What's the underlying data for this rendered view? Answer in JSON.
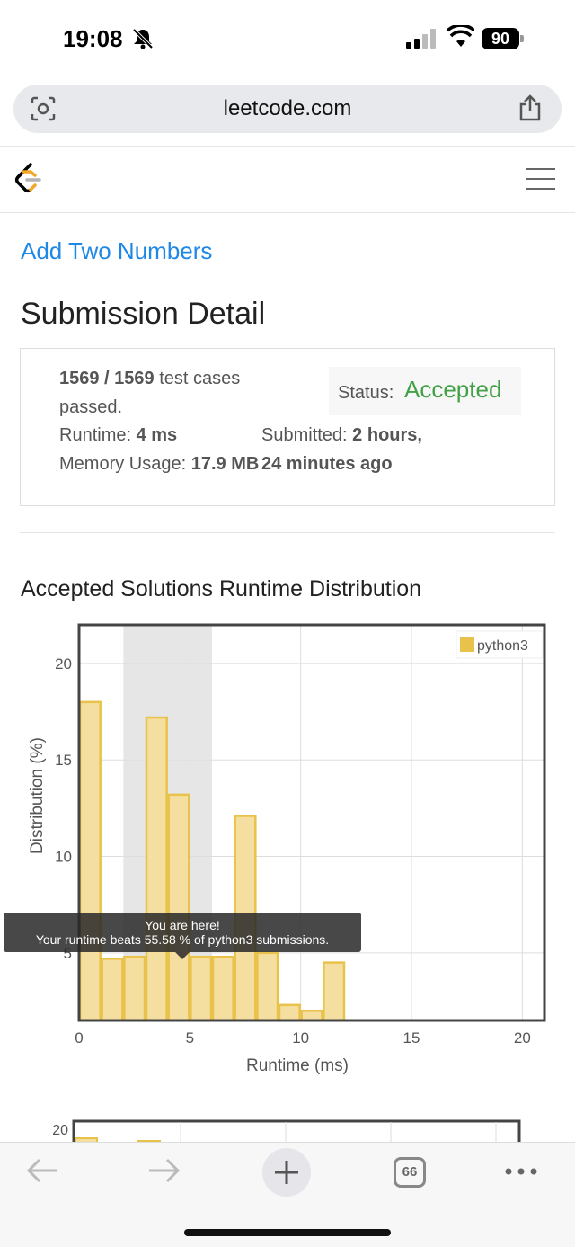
{
  "status_bar": {
    "time": "19:08",
    "battery": "90"
  },
  "browser": {
    "url": "leetcode.com"
  },
  "problem": {
    "title": "Add Two Numbers"
  },
  "page": {
    "title": "Submission Detail"
  },
  "summary": {
    "cases_passed": "1569 / 1569",
    "cases_suffix": "test cases",
    "passed_word": "passed.",
    "runtime_label": "Runtime:",
    "runtime_value": "4 ms",
    "memory_label": "Memory Usage:",
    "memory_value": "17.9 MB",
    "status_label": "Status:",
    "status_value": "Accepted",
    "submitted_label": "Submitted:",
    "submitted_value_1": "2 hours,",
    "submitted_value_2": "24 minutes ago"
  },
  "chart_title": "Accepted Solutions Runtime Distribution",
  "chart_data": {
    "type": "bar",
    "xlabel": "Runtime (ms)",
    "ylabel": "Distribution (%)",
    "xlim": [
      0,
      21
    ],
    "ylim": [
      1.5,
      22
    ],
    "xticks": [
      0,
      5,
      10,
      15,
      20
    ],
    "yticks": [
      5,
      10,
      15,
      20
    ],
    "grid": true,
    "legend": "top-right",
    "series": [
      {
        "name": "python3",
        "color": "#e8c24a",
        "x": [
          0,
          1,
          2,
          3,
          4,
          5,
          6,
          7,
          8,
          9,
          10,
          11
        ],
        "values": [
          18.0,
          4.7,
          4.8,
          17.2,
          13.2,
          4.8,
          4.8,
          12.1,
          5.0,
          2.3,
          2.0,
          4.5
        ]
      }
    ],
    "highlight_range": [
      2,
      6
    ],
    "tooltip_line1": "You are here!",
    "tooltip_line2": "Your runtime beats 55.58 % of python3 submissions."
  },
  "chart2_tick": "20",
  "toolbar": {
    "tabs_count": "66"
  }
}
